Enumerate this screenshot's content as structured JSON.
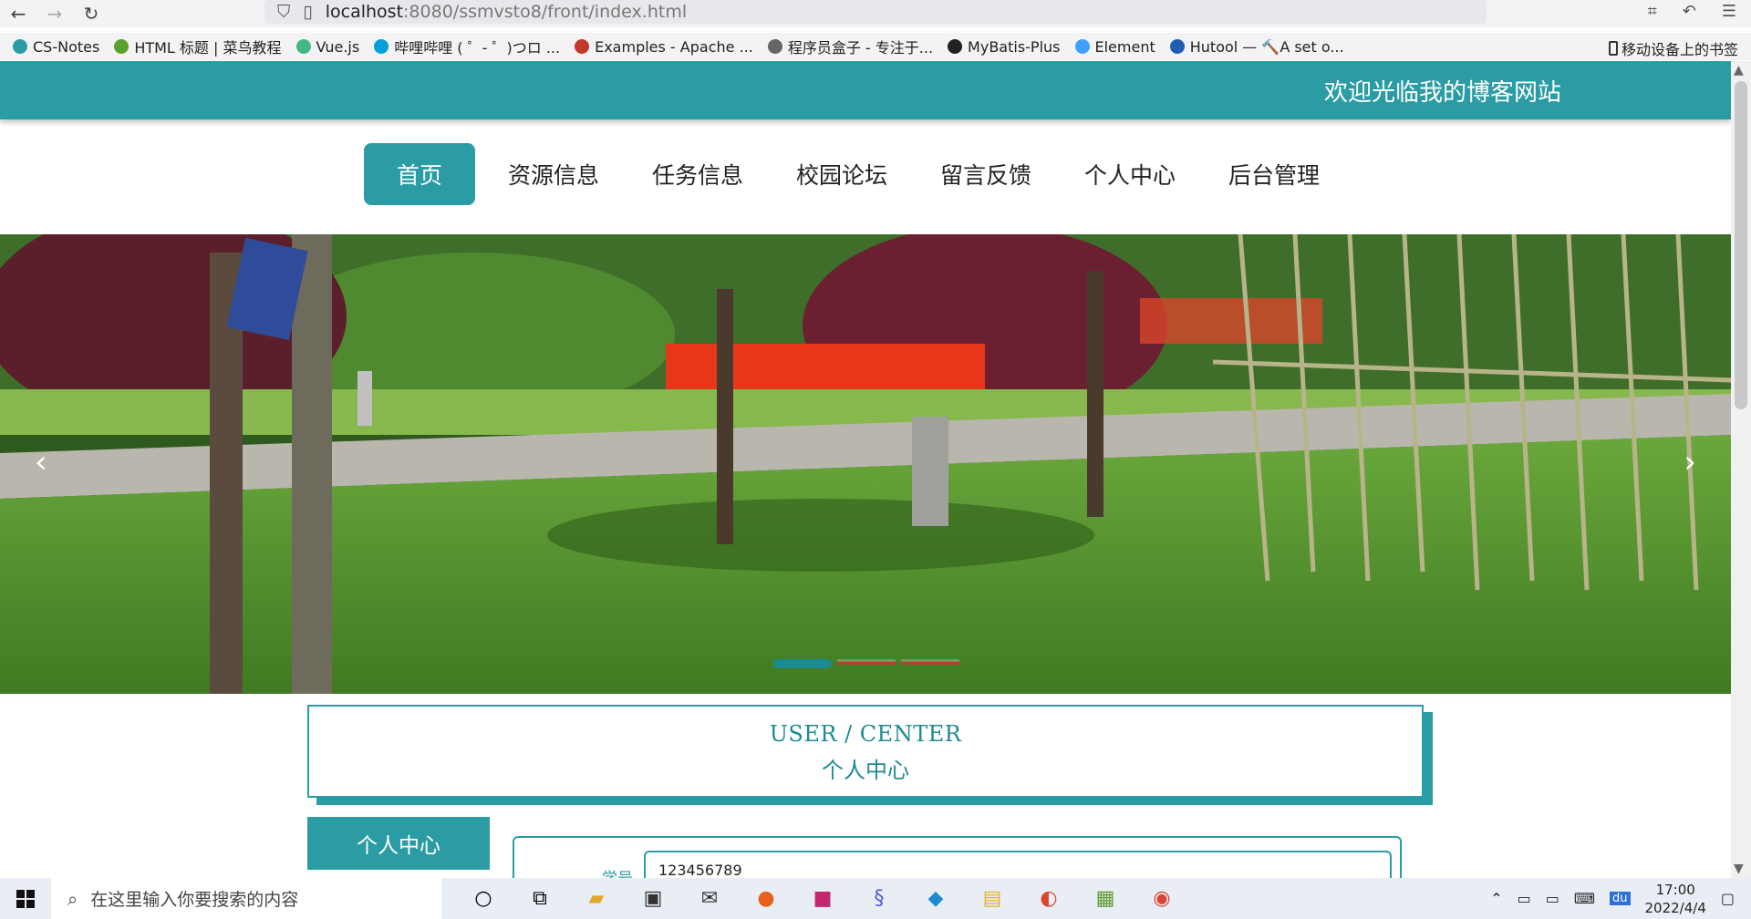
{
  "browser": {
    "url_host": "localhost",
    "url_rest": ":8080/ssmvsto8/front/index.html",
    "bookmarks": [
      {
        "label": "CS-Notes",
        "color": "#2b9ca3"
      },
      {
        "label": "HTML 标题 | 菜鸟教程",
        "color": "#5aa02c"
      },
      {
        "label": "Vue.js",
        "color": "#41b883"
      },
      {
        "label": "哔哩哔哩 ( ゜- ゜)つロ ...",
        "color": "#00a1d6"
      },
      {
        "label": "Examples - Apache ...",
        "color": "#c0392b"
      },
      {
        "label": "程序员盒子 - 专注于...",
        "color": "#666666"
      },
      {
        "label": "MyBatis-Plus",
        "color": "#222222"
      },
      {
        "label": "Element",
        "color": "#409eff"
      },
      {
        "label": "Hutool — 🔨A set o...",
        "color": "#1e5fb3"
      }
    ],
    "mobile_bookmarks": "移动设备上的书签"
  },
  "header": {
    "welcome": "欢迎光临我的博客网站"
  },
  "nav": {
    "items": [
      "首页",
      "资源信息",
      "任务信息",
      "校园论坛",
      "留言反馈",
      "个人中心",
      "后台管理"
    ],
    "active_index": 0
  },
  "carousel": {
    "prev_icon": "chevron-left-icon",
    "next_icon": "chevron-right-icon",
    "slides": 3,
    "active_slide": 1
  },
  "section": {
    "title_en": "USER / CENTER",
    "title_zh": "个人中心"
  },
  "sidebar": {
    "tab_label": "个人中心"
  },
  "form": {
    "student_id_label": "学号",
    "student_id_value": "123456789"
  },
  "taskbar": {
    "search_placeholder": "在这里输入你要搜索的内容",
    "time": "17:00",
    "date": "2022/4/4",
    "accent": "#2b9ca3"
  }
}
